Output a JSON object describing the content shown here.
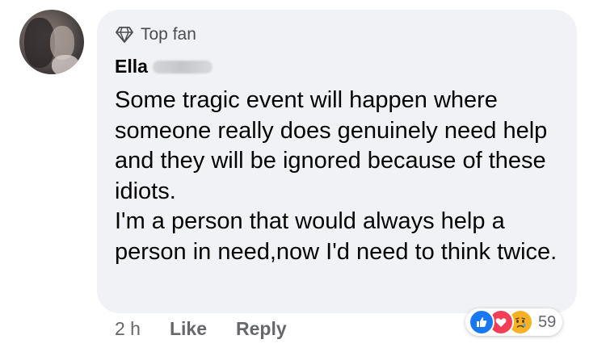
{
  "comment": {
    "badge_label": "Top fan",
    "author_name": "Ella",
    "text_lines": [
      "Some tragic event will happen where someone really does genuinely need help and they will be ignored because of these idiots.",
      "I'm a person that would always help a person in need,now I'd need to think twice."
    ],
    "timestamp": "2 h",
    "like_label": "Like",
    "reply_label": "Reply",
    "reaction_count": "59",
    "reactions": [
      "like",
      "love",
      "sad"
    ]
  },
  "colors": {
    "bubble": "#f0f2f5",
    "secondary_text": "#65676b",
    "like": "#1877f2",
    "love": "#f33e58",
    "sad": "#f7b125"
  }
}
